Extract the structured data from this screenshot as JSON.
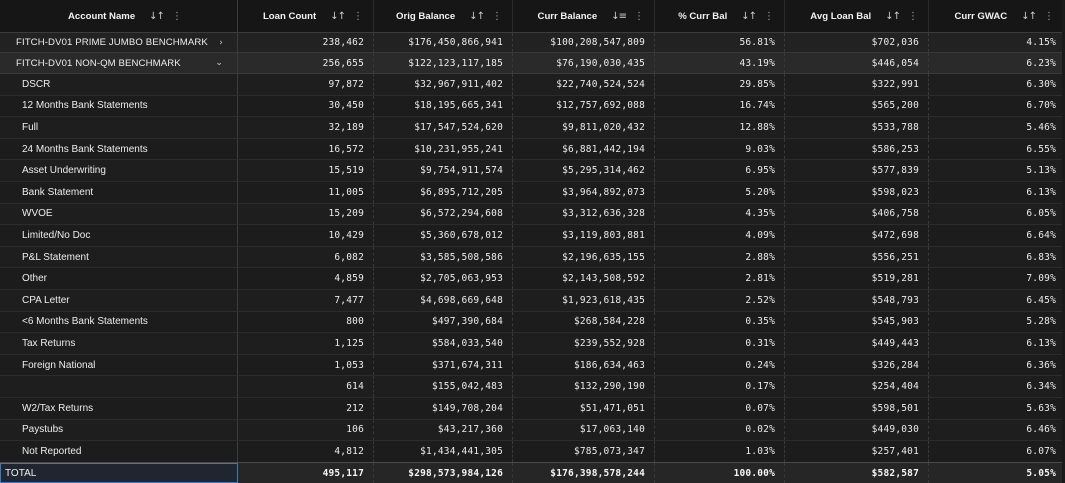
{
  "headers": [
    {
      "label": "Account Name",
      "sort": "↓↑"
    },
    {
      "label": "Loan Count",
      "sort": "↓↑"
    },
    {
      "label": "Orig Balance",
      "sort": "↓↑"
    },
    {
      "label": "Curr Balance",
      "sort": "↓≡"
    },
    {
      "label": "% Curr Bal",
      "sort": "↓↑"
    },
    {
      "label": "Avg Loan Bal",
      "sort": "↓↑"
    },
    {
      "label": "Curr GWAC",
      "sort": "↓↑"
    }
  ],
  "kebab": "⋮",
  "groups": [
    {
      "name": "FITCH-DV01 PRIME JUMBO BENCHMARK",
      "chevron": "›",
      "values": [
        "238,462",
        "$176,450,866,941",
        "$100,208,547,809",
        "56.81%",
        "$702,036",
        "4.15%"
      ]
    },
    {
      "name": "FITCH-DV01 NON-QM BENCHMARK",
      "chevron": "⌄",
      "values": [
        "256,655",
        "$122,123,117,185",
        "$76,190,030,435",
        "43.19%",
        "$446,054",
        "6.23%"
      ]
    }
  ],
  "rows": [
    {
      "name": "DSCR",
      "values": [
        "97,872",
        "$32,967,911,402",
        "$22,740,524,524",
        "29.85%",
        "$322,991",
        "6.30%"
      ]
    },
    {
      "name": "12 Months Bank Statements",
      "values": [
        "30,450",
        "$18,195,665,341",
        "$12,757,692,088",
        "16.74%",
        "$565,200",
        "6.70%"
      ]
    },
    {
      "name": "Full",
      "values": [
        "32,189",
        "$17,547,524,620",
        "$9,811,020,432",
        "12.88%",
        "$533,788",
        "5.46%"
      ]
    },
    {
      "name": "24 Months Bank Statements",
      "values": [
        "16,572",
        "$10,231,955,241",
        "$6,881,442,194",
        "9.03%",
        "$586,253",
        "6.55%"
      ]
    },
    {
      "name": "Asset Underwriting",
      "values": [
        "15,519",
        "$9,754,911,574",
        "$5,295,314,462",
        "6.95%",
        "$577,839",
        "5.13%"
      ]
    },
    {
      "name": "Bank Statement",
      "values": [
        "11,005",
        "$6,895,712,205",
        "$3,964,892,073",
        "5.20%",
        "$598,023",
        "6.13%"
      ]
    },
    {
      "name": "WVOE",
      "values": [
        "15,209",
        "$6,572,294,608",
        "$3,312,636,328",
        "4.35%",
        "$406,758",
        "6.05%"
      ]
    },
    {
      "name": "Limited/No Doc",
      "values": [
        "10,429",
        "$5,360,678,012",
        "$3,119,803,881",
        "4.09%",
        "$472,698",
        "6.64%"
      ]
    },
    {
      "name": "P&L Statement",
      "values": [
        "6,082",
        "$3,585,508,586",
        "$2,196,635,155",
        "2.88%",
        "$556,251",
        "6.83%"
      ]
    },
    {
      "name": "Other",
      "values": [
        "4,859",
        "$2,705,063,953",
        "$2,143,508,592",
        "2.81%",
        "$519,281",
        "7.09%"
      ]
    },
    {
      "name": "CPA Letter",
      "values": [
        "7,477",
        "$4,698,669,648",
        "$1,923,618,435",
        "2.52%",
        "$548,793",
        "6.45%"
      ]
    },
    {
      "name": "<6 Months Bank Statements",
      "values": [
        "800",
        "$497,390,684",
        "$268,584,228",
        "0.35%",
        "$545,903",
        "5.28%"
      ]
    },
    {
      "name": "Tax Returns",
      "values": [
        "1,125",
        "$584,033,540",
        "$239,552,928",
        "0.31%",
        "$449,443",
        "6.13%"
      ]
    },
    {
      "name": "Foreign National",
      "values": [
        "1,053",
        "$371,674,311",
        "$186,634,463",
        "0.24%",
        "$326,284",
        "6.36%"
      ]
    },
    {
      "name": "",
      "values": [
        "614",
        "$155,042,483",
        "$132,290,190",
        "0.17%",
        "$254,404",
        "6.34%"
      ]
    },
    {
      "name": "W2/Tax Returns",
      "values": [
        "212",
        "$149,708,204",
        "$51,471,051",
        "0.07%",
        "$598,501",
        "5.63%"
      ]
    },
    {
      "name": "Paystubs",
      "values": [
        "106",
        "$43,217,360",
        "$17,063,140",
        "0.02%",
        "$449,030",
        "6.46%"
      ]
    },
    {
      "name": "Not Reported",
      "values": [
        "4,812",
        "$1,434,441,305",
        "$785,073,347",
        "1.03%",
        "$257,401",
        "6.07%"
      ]
    }
  ],
  "total": {
    "name": "TOTAL",
    "values": [
      "495,117",
      "$298,573,984,126",
      "$176,398,578,244",
      "100.00%",
      "$582,587",
      "5.05%"
    ]
  }
}
